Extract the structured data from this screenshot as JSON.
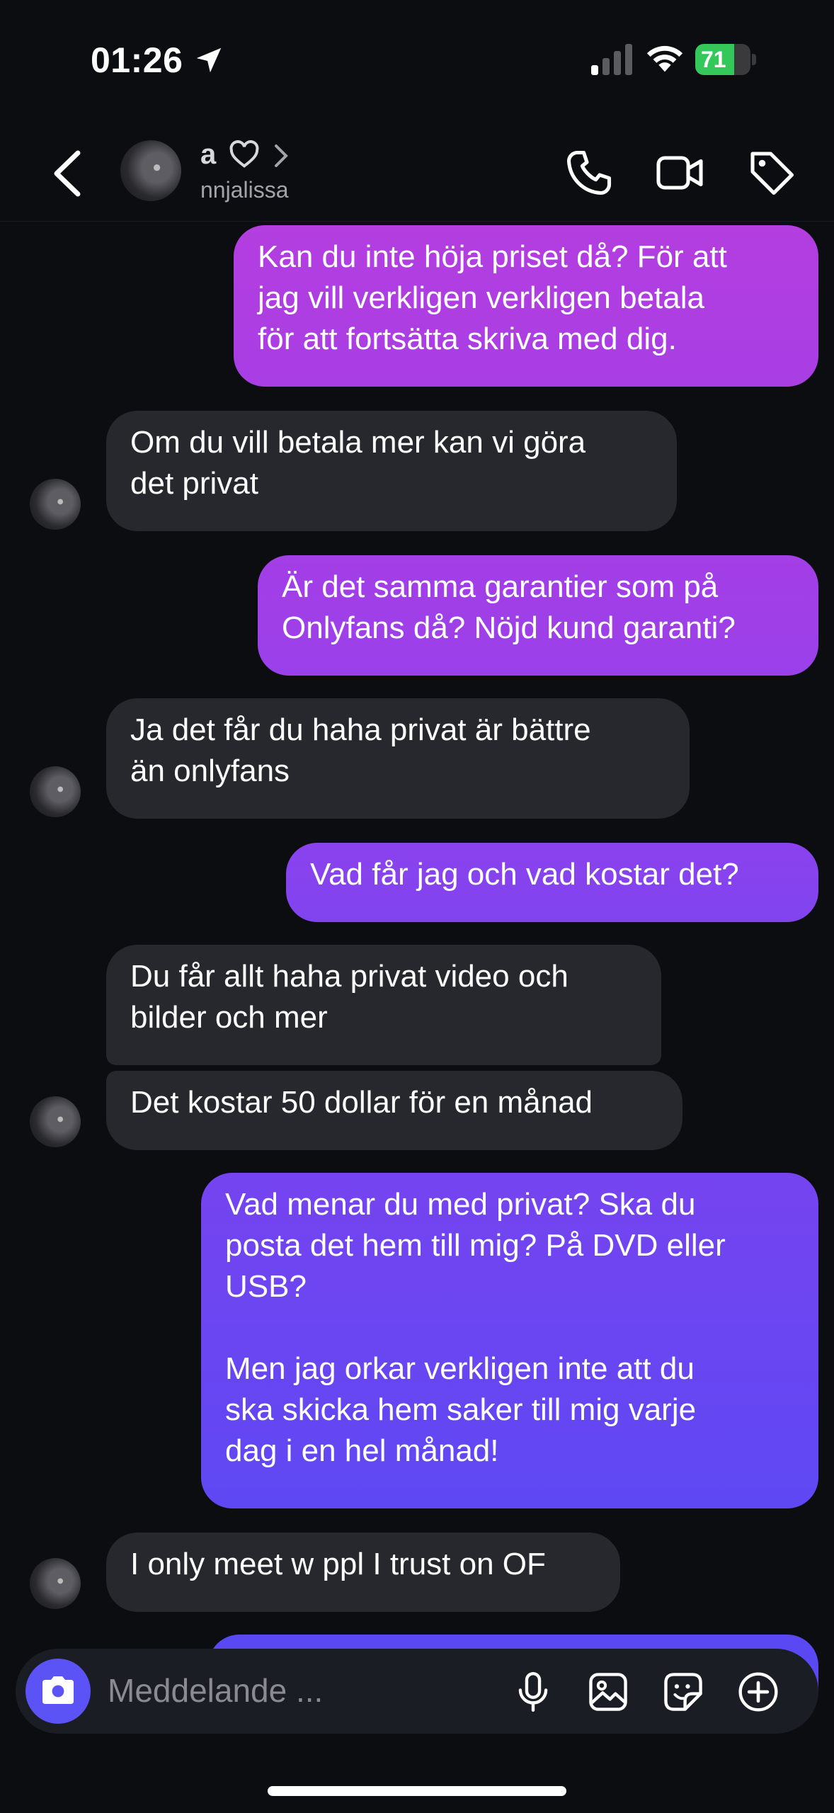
{
  "status_bar": {
    "time": "01:26",
    "battery": "71",
    "battery_level": 0.71
  },
  "header": {
    "name": "a",
    "username": "nnjalissa"
  },
  "messages": [
    {
      "from": "me",
      "text": "Kan du inte höja priset då? För att\njag vill verkligen verkligen betala\nför att fortsätta skriva med dig."
    },
    {
      "from": "them",
      "text": "Om du vill betala mer kan vi göra\ndet privat"
    },
    {
      "from": "me",
      "text": "Är det samma garantier som på\nOnlyfans då? Nöjd kund garanti?"
    },
    {
      "from": "them",
      "text": "Ja det får du haha privat är bättre\nän onlyfans"
    },
    {
      "from": "me",
      "text": "Vad får jag och vad kostar det?"
    },
    {
      "from": "them",
      "text": "Du får allt haha privat video och\nbilder och mer"
    },
    {
      "from": "them",
      "text": "Det kostar 50 dollar för en månad"
    },
    {
      "from": "me",
      "text": "Vad menar du med privat? Ska du\nposta det hem till mig? På DVD eller\nUSB?\n\nMen jag orkar verkligen inte att du\nska skicka hem saker till mig varje\ndag i en hel månad!"
    },
    {
      "from": "them",
      "text": "I only meet w ppl I trust on OF"
    }
  ],
  "composer": {
    "placeholder": "Meddelande ..."
  },
  "colors": {
    "background": "#0b0d11",
    "incoming_bubble": "#26282d",
    "outgoing_top": "#b43ee0",
    "outgoing_bottom": "#5a48f2",
    "accent": "#5b53f5",
    "battery": "#34c759"
  },
  "icons": [
    "location-arrow-icon",
    "signal-icon",
    "wifi-icon",
    "battery-icon",
    "back-chevron-icon",
    "heart-icon",
    "chevron-right-icon",
    "phone-icon",
    "video-camera-icon",
    "tag-icon",
    "camera-icon",
    "microphone-icon",
    "image-icon",
    "sticker-icon",
    "plus-circle-icon"
  ]
}
